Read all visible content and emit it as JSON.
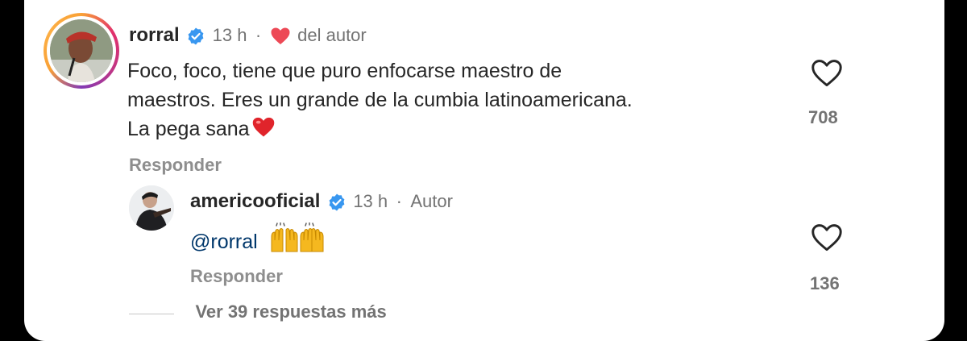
{
  "comment": {
    "username": "rorral",
    "time": "13 h",
    "separator": "·",
    "liked_by_author": "del autor",
    "text_line1": "Foco, foco, tiene que puro enfocarse maestro de",
    "text_line2": "maestros. Eres un grande de la cumbia latinoamericana.",
    "text_line3": "La pega sana",
    "like_count": "708",
    "reply_label": "Responder"
  },
  "reply": {
    "username": "americooficial",
    "time": "13 h",
    "separator": "·",
    "author_label": "Autor",
    "mention": "@rorral",
    "like_count": "136",
    "reply_label": "Responder",
    "more_replies": "Ver 39 respuestas más"
  },
  "colors": {
    "verified": "#3897f0",
    "heart": "#ed4956",
    "mention": "#00376b"
  },
  "icons": [
    "verified-badge-icon",
    "heart-filled-icon",
    "heart-outline-icon",
    "raising-hands-emoji"
  ]
}
